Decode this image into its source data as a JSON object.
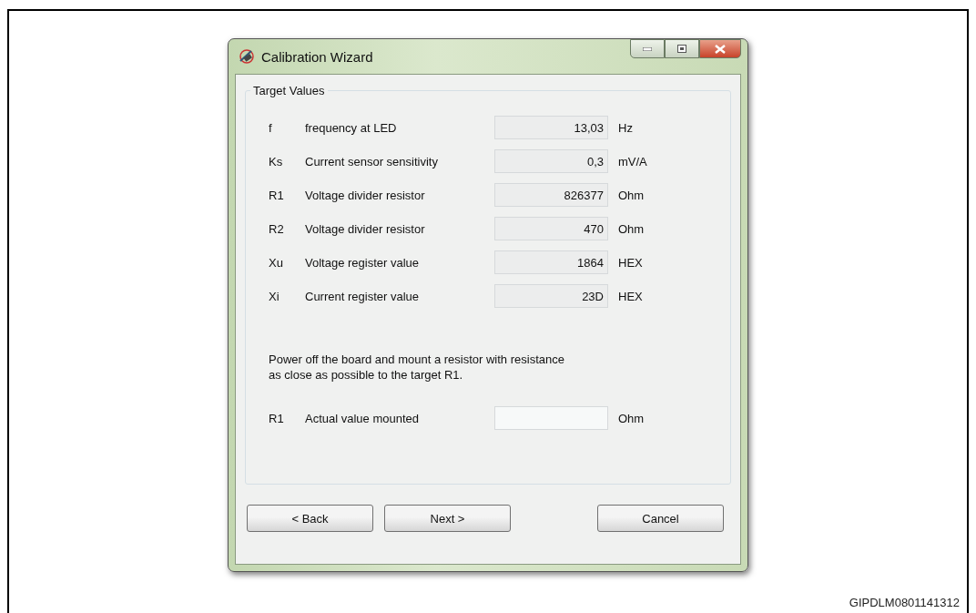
{
  "window": {
    "title": "Calibration Wizard"
  },
  "group": {
    "title": "Target Values"
  },
  "parameters": [
    {
      "symbol": "f",
      "label": "frequency at LED",
      "value": "13,03",
      "unit": "Hz"
    },
    {
      "symbol": "Ks",
      "label": "Current sensor sensitivity",
      "value": "0,3",
      "unit": "mV/A"
    },
    {
      "symbol": "R1",
      "label": "Voltage divider resistor",
      "value": "826377",
      "unit": "Ohm"
    },
    {
      "symbol": "R2",
      "label": "Voltage divider resistor",
      "value": "470",
      "unit": "Ohm"
    },
    {
      "symbol": "Xu",
      "label": "Voltage register value",
      "value": "1864",
      "unit": "HEX"
    },
    {
      "symbol": "Xi",
      "label": "Current register value",
      "value": "23D",
      "unit": "HEX"
    }
  ],
  "instruction": "Power off the board and mount a resistor with resistance\nas close as possible to the target R1.",
  "actual": {
    "symbol": "R1",
    "label": "Actual value mounted",
    "unit": "Ohm"
  },
  "buttons": [
    {
      "label": "< Back",
      "kind": "left"
    },
    {
      "label": "Next >",
      "kind": "left"
    },
    {
      "label": "Cancel",
      "kind": "right"
    }
  ],
  "figure_id": "GIPDLM0801141312"
}
